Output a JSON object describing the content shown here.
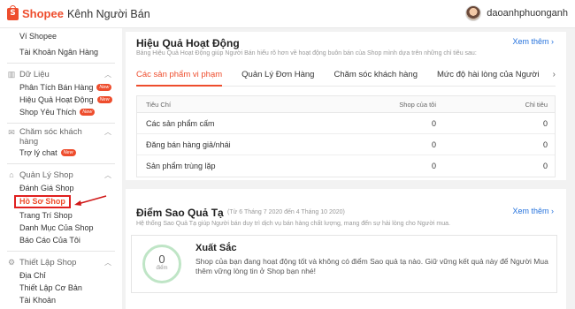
{
  "header": {
    "brand_name": "Shopee",
    "brand_sub": "Kênh Người Bán",
    "username": "daoanhphuonganh"
  },
  "sidebar": {
    "top_items": [
      {
        "label": "Ví Shopee"
      },
      {
        "label": "Tài Khoản Ngân Hàng"
      }
    ],
    "groups": [
      {
        "title": "Dữ Liệu",
        "items": [
          {
            "label": "Phân Tích Bán Hàng",
            "badge": "New"
          },
          {
            "label": "Hiệu Quả Hoạt Động",
            "badge": "New"
          },
          {
            "label": "Shop Yêu Thích",
            "badge": "New"
          }
        ]
      },
      {
        "title_line1": "Chăm sóc khách",
        "title_line2": "hàng",
        "items": [
          {
            "label": "Trợ lý chat",
            "badge": "New"
          }
        ]
      },
      {
        "title": "Quản Lý Shop",
        "items": [
          {
            "label": "Đánh Giá Shop"
          },
          {
            "label": "Hồ Sơ Shop"
          },
          {
            "label": "Trang Trí Shop"
          },
          {
            "label": "Danh Mục Của Shop"
          },
          {
            "label": "Báo Cáo Của Tôi"
          }
        ]
      },
      {
        "title": "Thiết Lập Shop",
        "items": [
          {
            "label": "Địa Chỉ"
          },
          {
            "label": "Thiết Lập Cơ Bản"
          },
          {
            "label": "Tài Khoản"
          }
        ]
      }
    ]
  },
  "performance": {
    "title": "Hiệu Quả Hoạt Động",
    "description": "Bảng Hiệu Quả Hoạt Động giúp Người Bán hiểu rõ hơn về hoạt động buôn bán của Shop mình dựa trên những chỉ tiêu sau:",
    "see_all": "Xem thêm",
    "tabs": [
      {
        "label": "Các sản phẩm vi phạm"
      },
      {
        "label": "Quản Lý Đơn Hàng"
      },
      {
        "label": "Chăm sóc khách hàng"
      },
      {
        "label": "Mức độ hài lòng của Người"
      }
    ],
    "table": {
      "headers": [
        "Tiêu Chí",
        "Shop của tôi",
        "Chỉ tiêu"
      ],
      "rows": [
        {
          "criterion": "Các sản phẩm cấm",
          "mine": "0",
          "target": "0"
        },
        {
          "criterion": "Đăng bán hàng giả/nhái",
          "mine": "0",
          "target": "0"
        },
        {
          "criterion": "Sản phẩm trùng lặp",
          "mine": "0",
          "target": "0"
        }
      ]
    }
  },
  "penalty": {
    "title": "Điểm Sao Quả Tạ",
    "range": "(Từ 6 Tháng 7 2020 đến 4 Tháng 10 2020)",
    "see_all": "Xem thêm",
    "description": "Hệ thống Sao Quả Tạ giúp Người bán duy trì dịch vụ bán hàng chất lượng, mang đến sự hài lòng cho Người mua.",
    "score": "0",
    "score_unit": "điểm",
    "grade": "Xuất Sắc",
    "message": "Shop của bạn đang hoạt động tốt và không có điểm Sao quả tạ nào. Giữ vững kết quả này để Người Mua thêm vững lòng tin ở Shop bạn nhé!"
  },
  "colors": {
    "brand": "#ee4d2d",
    "link": "#2673dd",
    "highlight_box": "#e02020",
    "score_ring": "#bfe5c6"
  }
}
